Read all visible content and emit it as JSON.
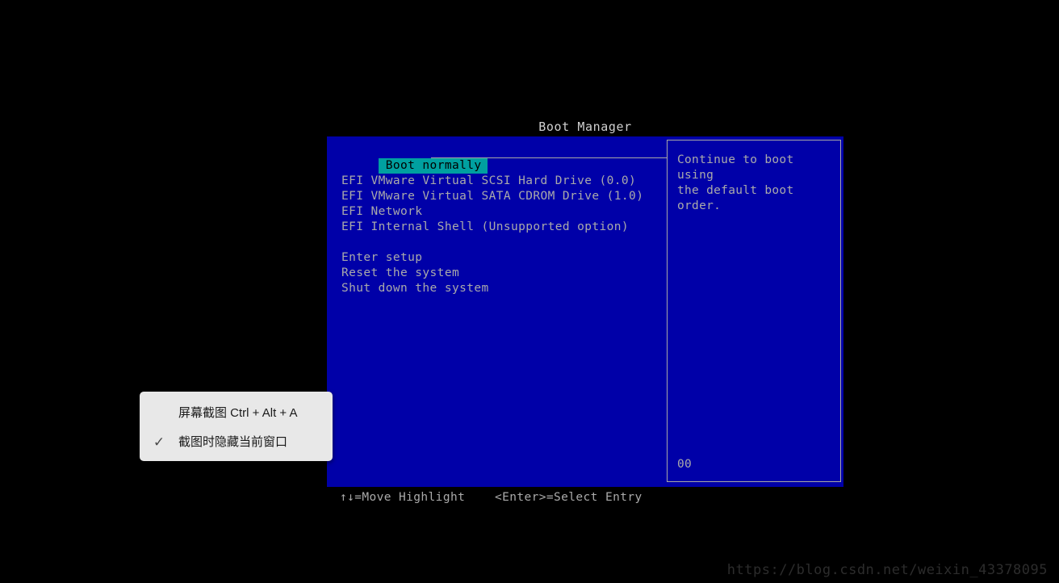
{
  "screen": {
    "background_color": "#000000"
  },
  "bios": {
    "title": "Boot Manager",
    "window_bg_color": "#0000a8",
    "text_color": "#aaaaaa",
    "highlight_bg_color": "#00a0a0",
    "highlight_fg_color": "#000000",
    "menu_items": [
      {
        "label": "Boot normally",
        "selected": true,
        "spacer_after": true
      },
      {
        "label": "EFI VMware Virtual SCSI Hard Drive (0.0)",
        "selected": false,
        "spacer_after": false
      },
      {
        "label": "EFI VMware Virtual SATA CDROM Drive (1.0)",
        "selected": false,
        "spacer_after": false
      },
      {
        "label": "EFI Network",
        "selected": false,
        "spacer_after": false
      },
      {
        "label": "EFI Internal Shell (Unsupported option)",
        "selected": false,
        "spacer_after": true
      },
      {
        "label": "Enter setup",
        "selected": false,
        "spacer_after": false
      },
      {
        "label": "Reset the system",
        "selected": false,
        "spacer_after": false
      },
      {
        "label": "Shut down the system",
        "selected": false,
        "spacer_after": false
      }
    ],
    "help": {
      "text": "Continue to boot using\nthe default boot order.",
      "code": "00"
    },
    "status": {
      "move_hint": "↑↓=Move Highlight",
      "select_hint": "<Enter>=Select Entry"
    }
  },
  "context_menu": {
    "items": [
      {
        "label": "屏幕截图 Ctrl + Alt + A",
        "checked": false,
        "check_glyph": ""
      },
      {
        "label": "截图时隐藏当前窗口",
        "checked": true,
        "check_glyph": "✓"
      }
    ]
  },
  "watermark": {
    "text": "https://blog.csdn.net/weixin_43378095"
  }
}
